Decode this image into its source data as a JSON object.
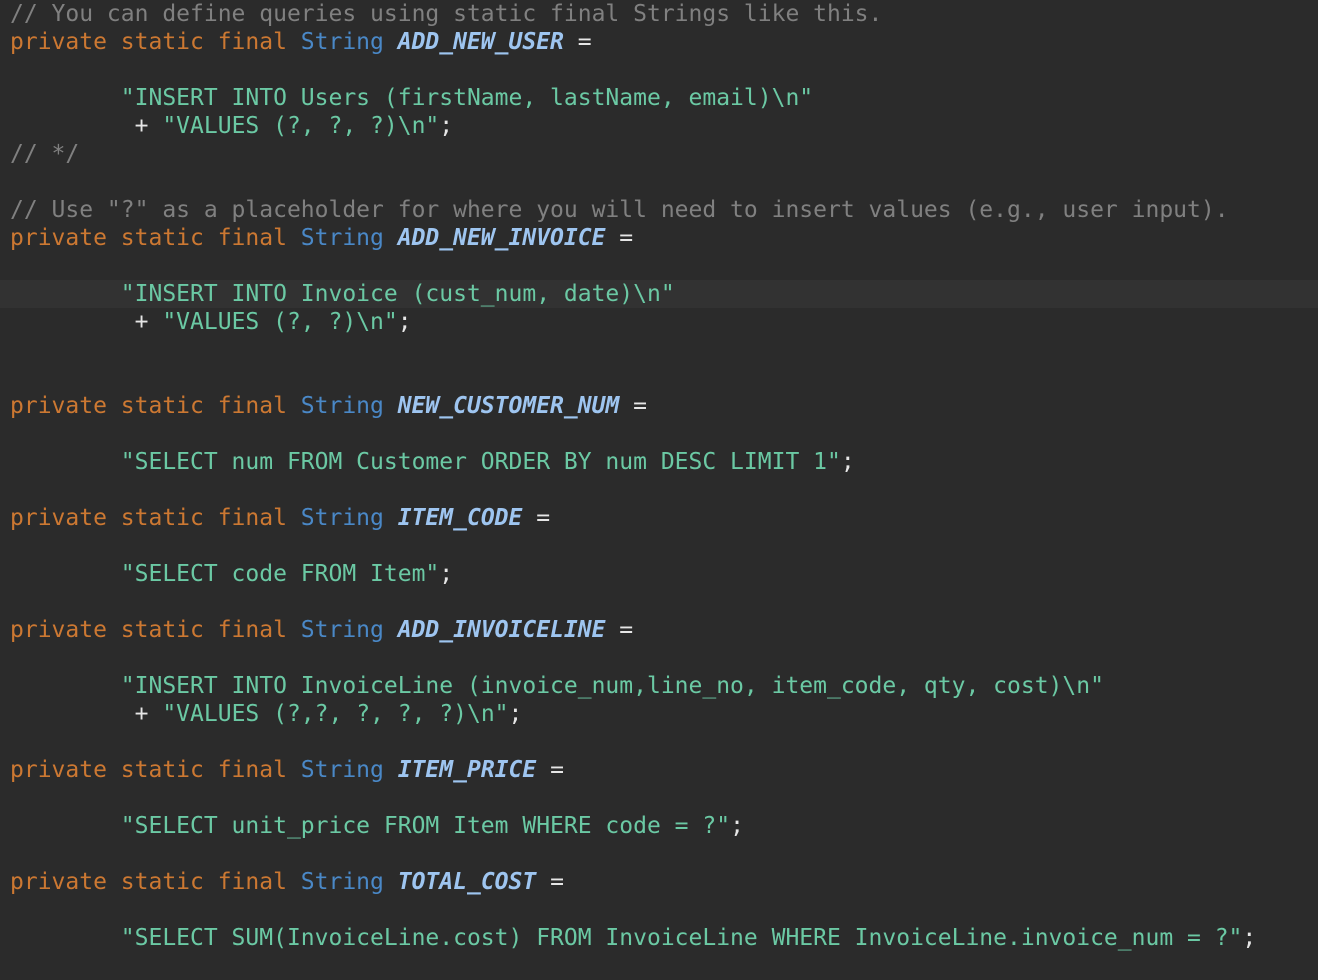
{
  "editor": {
    "background": "#2b2b2b",
    "current_line_background": "#323232",
    "highlighted_line_index": 10,
    "lines": [
      [
        {
          "t": "comment",
          "v": "// You can define queries using static final Strings like this."
        }
      ],
      [
        {
          "t": "keyword",
          "v": "private static final "
        },
        {
          "t": "type",
          "v": "String "
        },
        {
          "t": "const",
          "v": "ADD_NEW_USER"
        },
        {
          "t": "op",
          "v": " ="
        }
      ],
      [],
      [
        {
          "t": "plain",
          "v": "        "
        },
        {
          "t": "string",
          "v": "\"INSERT INTO Users (firstName, lastName, email)\\n\""
        }
      ],
      [
        {
          "t": "plain",
          "v": "         "
        },
        {
          "t": "op",
          "v": "+ "
        },
        {
          "t": "string",
          "v": "\"VALUES (?, ?, ?)\\n\""
        },
        {
          "t": "op",
          "v": ";"
        }
      ],
      [
        {
          "t": "comment",
          "v": "// */"
        }
      ],
      [],
      [
        {
          "t": "comment",
          "v": "// Use \"?\" as a placeholder for where you will need to insert values (e.g., user input)."
        }
      ],
      [
        {
          "t": "keyword",
          "v": "private static final "
        },
        {
          "t": "type",
          "v": "String "
        },
        {
          "t": "const",
          "v": "ADD_NEW_INVOICE"
        },
        {
          "t": "op",
          "v": " ="
        }
      ],
      [],
      [
        {
          "t": "plain",
          "v": "        "
        },
        {
          "t": "string",
          "v": "\"INSERT INTO Invoice (cust_num, date)\\n\""
        }
      ],
      [
        {
          "t": "plain",
          "v": "         "
        },
        {
          "t": "op",
          "v": "+ "
        },
        {
          "t": "string",
          "v": "\"VALUES (?, ?)\\n\""
        },
        {
          "t": "op",
          "v": ";"
        }
      ],
      [],
      [],
      [
        {
          "t": "keyword",
          "v": "private static final "
        },
        {
          "t": "type",
          "v": "String "
        },
        {
          "t": "const",
          "v": "NEW_CUSTOMER_NUM"
        },
        {
          "t": "op",
          "v": " ="
        }
      ],
      [],
      [
        {
          "t": "plain",
          "v": "        "
        },
        {
          "t": "string",
          "v": "\"SELECT num FROM Customer ORDER BY num DESC LIMIT 1\""
        },
        {
          "t": "op",
          "v": ";"
        }
      ],
      [],
      [
        {
          "t": "keyword",
          "v": "private static final "
        },
        {
          "t": "type",
          "v": "String "
        },
        {
          "t": "const",
          "v": "ITEM_CODE"
        },
        {
          "t": "op",
          "v": " ="
        }
      ],
      [],
      [
        {
          "t": "plain",
          "v": "        "
        },
        {
          "t": "string",
          "v": "\"SELECT code FROM Item\""
        },
        {
          "t": "op",
          "v": ";"
        }
      ],
      [],
      [
        {
          "t": "keyword",
          "v": "private static final "
        },
        {
          "t": "type",
          "v": "String "
        },
        {
          "t": "const",
          "v": "ADD_INVOICELINE"
        },
        {
          "t": "op",
          "v": " ="
        }
      ],
      [],
      [
        {
          "t": "plain",
          "v": "        "
        },
        {
          "t": "string",
          "v": "\"INSERT INTO InvoiceLine (invoice_num,line_no, item_code, qty, cost)\\n\""
        }
      ],
      [
        {
          "t": "plain",
          "v": "         "
        },
        {
          "t": "op",
          "v": "+ "
        },
        {
          "t": "string",
          "v": "\"VALUES (?,?, ?, ?, ?)\\n\""
        },
        {
          "t": "op",
          "v": ";"
        }
      ],
      [],
      [
        {
          "t": "keyword",
          "v": "private static final "
        },
        {
          "t": "type",
          "v": "String "
        },
        {
          "t": "const",
          "v": "ITEM_PRICE"
        },
        {
          "t": "op",
          "v": " ="
        }
      ],
      [],
      [
        {
          "t": "plain",
          "v": "        "
        },
        {
          "t": "string",
          "v": "\"SELECT unit_price FROM Item WHERE code = ?\""
        },
        {
          "t": "op",
          "v": ";"
        }
      ],
      [],
      [
        {
          "t": "keyword",
          "v": "private static final "
        },
        {
          "t": "type",
          "v": "String "
        },
        {
          "t": "const",
          "v": "TOTAL_COST"
        },
        {
          "t": "op",
          "v": " ="
        }
      ],
      [],
      [
        {
          "t": "plain",
          "v": "        "
        },
        {
          "t": "string",
          "v": "\"SELECT SUM(InvoiceLine.cost) FROM InvoiceLine WHERE InvoiceLine.invoice_num = ?\""
        },
        {
          "t": "op",
          "v": ";"
        }
      ],
      []
    ]
  }
}
